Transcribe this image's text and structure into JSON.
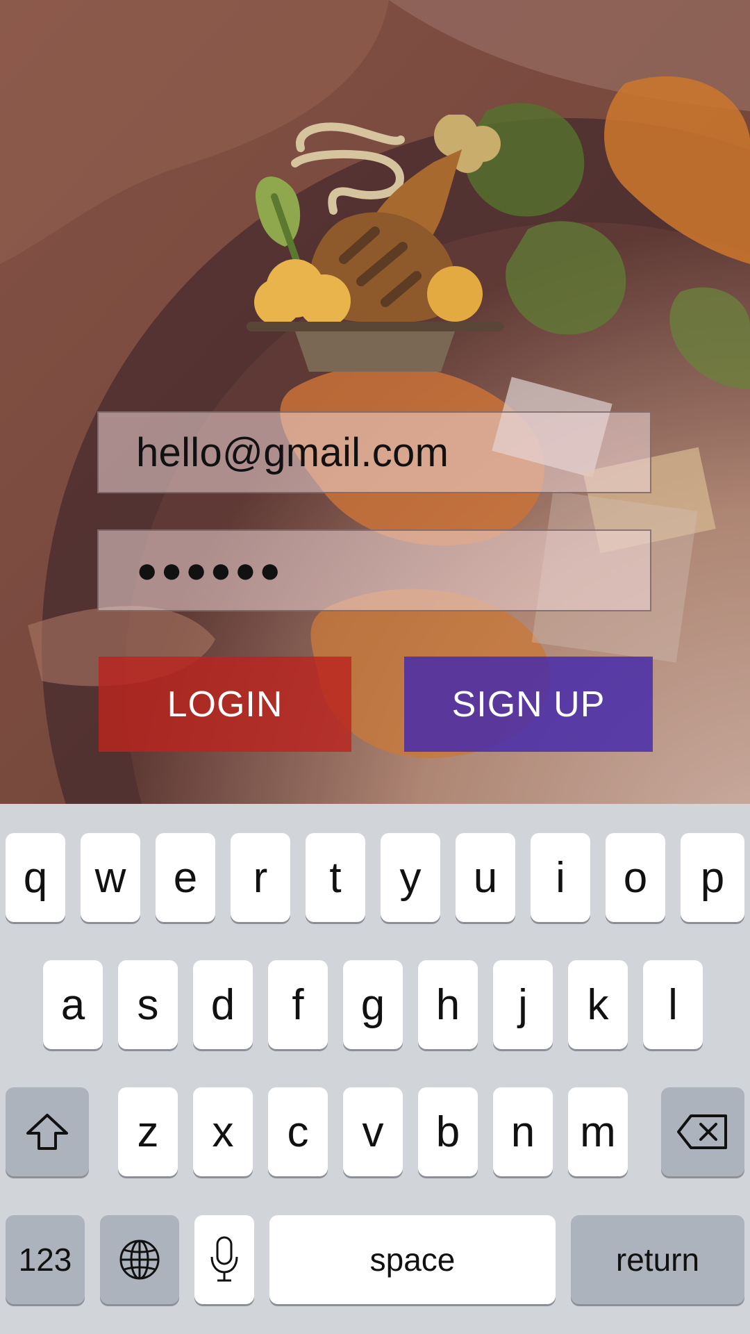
{
  "login_form": {
    "email_value": "hello@gmail.com",
    "password_mask": "●●●●●●",
    "login_label": "LOGIN",
    "signup_label": "SIGN UP"
  },
  "keyboard": {
    "row1": [
      "q",
      "w",
      "e",
      "r",
      "t",
      "y",
      "u",
      "i",
      "o",
      "p"
    ],
    "row2": [
      "a",
      "s",
      "d",
      "f",
      "g",
      "h",
      "j",
      "k",
      "l"
    ],
    "row3": [
      "z",
      "x",
      "c",
      "v",
      "b",
      "n",
      "m"
    ],
    "numbers_label": "123",
    "space_label": "space",
    "return_label": "return",
    "icons": {
      "shift": "shift-icon",
      "backspace": "backspace-icon",
      "globe": "globe-icon",
      "mic": "microphone-icon"
    }
  },
  "brand": {
    "logo_icon": "roast-chicken-icon"
  },
  "colors": {
    "login_button": "#BA241E",
    "signup_button": "#482CAA",
    "keyboard_bg": "#D1D4D9",
    "key_bg": "#FFFFFF",
    "special_key_bg": "#ADB3BC"
  }
}
